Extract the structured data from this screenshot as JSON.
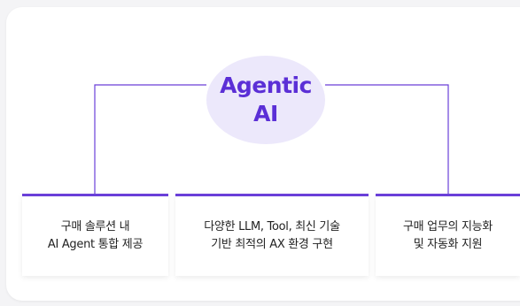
{
  "center": {
    "line1": "Agentic",
    "line2": "AI"
  },
  "features": [
    {
      "line1": "구매 솔루션 내",
      "line2": "AI Agent 통합 제공"
    },
    {
      "line1": "다양한 LLM, Tool, 최신 기술",
      "line2": "기반 최적의 AX 환경 구현"
    },
    {
      "line1": "구매 업무의 지능화",
      "line2": "및 자동화 지원"
    }
  ],
  "colors": {
    "accent": "#6a3fd8",
    "circle_bg": "#ece8fb",
    "title_text": "#5b2fd6",
    "card_bg": "#ffffff",
    "page_bg": "#f4f4f6"
  }
}
